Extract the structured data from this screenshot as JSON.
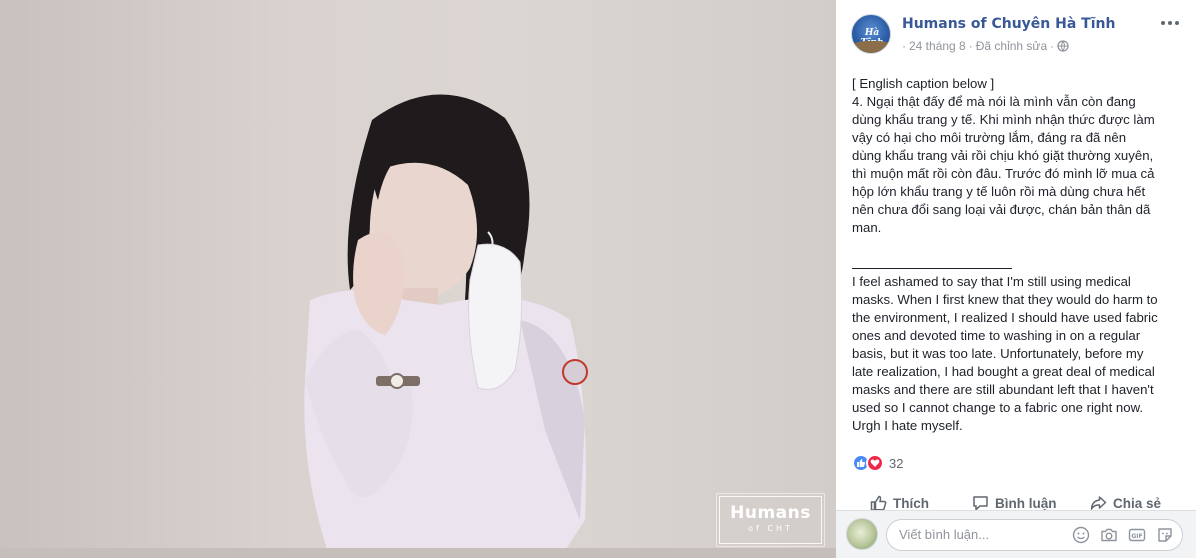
{
  "post": {
    "page_name": "Humans of Chuyên Hà Tĩnh",
    "date": "24 tháng 8",
    "meta_sep": "·",
    "edited": "Đã chỉnh sửa",
    "caption_lines": [
      "[ English caption below ]",
      "4. Ngại thật đấy để mà nói là mình vẫn còn đang",
      "dùng khẩu trang y tế. Khi mình nhận thức được làm",
      "vậy có hại cho môi trường lắm, đáng ra đã nên",
      "dùng khẩu trang vải rồi chịu khó giặt thường xuyên,",
      "thì muộn mất rồi còn đâu. Trước đó mình lỡ mua cả",
      "hộp lớn khẩu trang y tế luôn rồi mà dùng chưa hết",
      "nên chưa đổi sang loại vải được, chán bản thân dã",
      "man."
    ],
    "english_lines": [
      "I feel ashamed to say that I'm still using medical",
      "masks. When I first knew that they would do harm to",
      "the environment, I realized I should have used fabric",
      "ones and devoted time to washing in on a regular",
      "basis, but it was too late. Unfortunately, before my",
      "late realization, I had bought a great deal of medical",
      "masks and there are still abundant left that I haven't",
      "used so I cannot change to a fabric one right now.",
      "Urgh I hate myself."
    ],
    "reaction_count": "32"
  },
  "actions": {
    "like": "Thích",
    "comment": "Bình luận",
    "share": "Chia sẻ"
  },
  "comment_box": {
    "placeholder": "Viết bình luận..."
  },
  "photo": {
    "watermark_main": "Humans",
    "watermark_sub": "of CHT"
  },
  "avatar": {
    "label": "Hà Tĩnh"
  },
  "colors": {
    "page_name": "#385898",
    "like": "#4a8af4",
    "love": "#f0284a"
  }
}
